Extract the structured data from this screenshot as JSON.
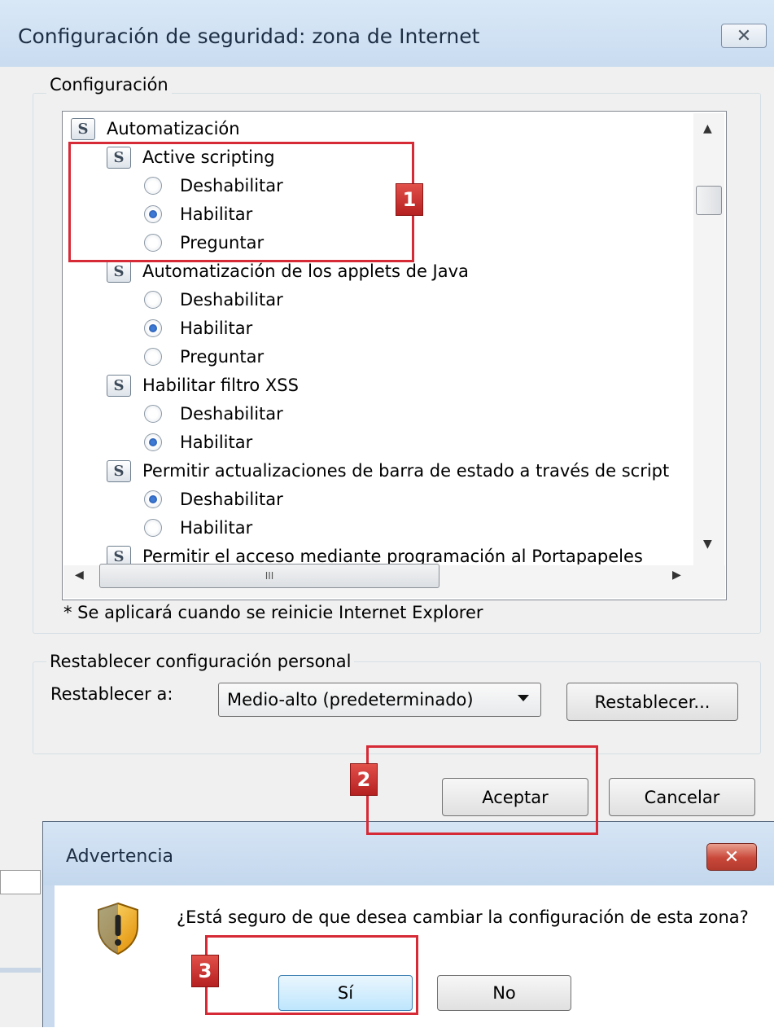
{
  "main_dialog": {
    "title": "Configuración de seguridad: zona de Internet",
    "close_glyph": "✕"
  },
  "settings_group": {
    "label": "Configuración",
    "tree": [
      {
        "kind": "category",
        "label": "Automatización",
        "indent": 0
      },
      {
        "kind": "category",
        "label": "Active scripting",
        "indent": 1
      },
      {
        "kind": "option",
        "label": "Deshabilitar",
        "checked": false
      },
      {
        "kind": "option",
        "label": "Habilitar",
        "checked": true
      },
      {
        "kind": "option",
        "label": "Preguntar",
        "checked": false
      },
      {
        "kind": "category",
        "label": "Automatización de los applets de Java",
        "indent": 1
      },
      {
        "kind": "option",
        "label": "Deshabilitar",
        "checked": false
      },
      {
        "kind": "option",
        "label": "Habilitar",
        "checked": true
      },
      {
        "kind": "option",
        "label": "Preguntar",
        "checked": false
      },
      {
        "kind": "category",
        "label": "Habilitar filtro XSS",
        "indent": 1
      },
      {
        "kind": "option",
        "label": "Deshabilitar",
        "checked": false
      },
      {
        "kind": "option",
        "label": "Habilitar",
        "checked": true
      },
      {
        "kind": "category",
        "label": "Permitir actualizaciones de barra de estado a través de script",
        "indent": 1
      },
      {
        "kind": "option",
        "label": "Deshabilitar",
        "checked": true
      },
      {
        "kind": "option",
        "label": "Habilitar",
        "checked": false
      },
      {
        "kind": "category",
        "label": "Permitir el acceso mediante programación al Portapapeles",
        "indent": 1
      }
    ],
    "hscroll_grip": "III",
    "note": "* Se aplicará cuando se reinicie Internet Explorer"
  },
  "reset_group": {
    "label": "Restablecer configuración personal",
    "reset_to_label": "Restablecer a:",
    "reset_level": "Medio-alto (predeterminado)",
    "reset_button": "Restablecer..."
  },
  "footer": {
    "ok_button": "Aceptar",
    "cancel_button": "Cancelar"
  },
  "warning_dialog": {
    "title": "Advertencia",
    "close_glyph": "✕",
    "message": "¿Está seguro de que desea cambiar la configuración de esta zona?",
    "yes_button": "Sí",
    "no_button": "No"
  },
  "annotations": [
    {
      "label": "1"
    },
    {
      "label": "2"
    },
    {
      "label": "3"
    }
  ],
  "colors": {
    "annotation": "#d62a36",
    "titlebar": "#c9dcf0"
  }
}
